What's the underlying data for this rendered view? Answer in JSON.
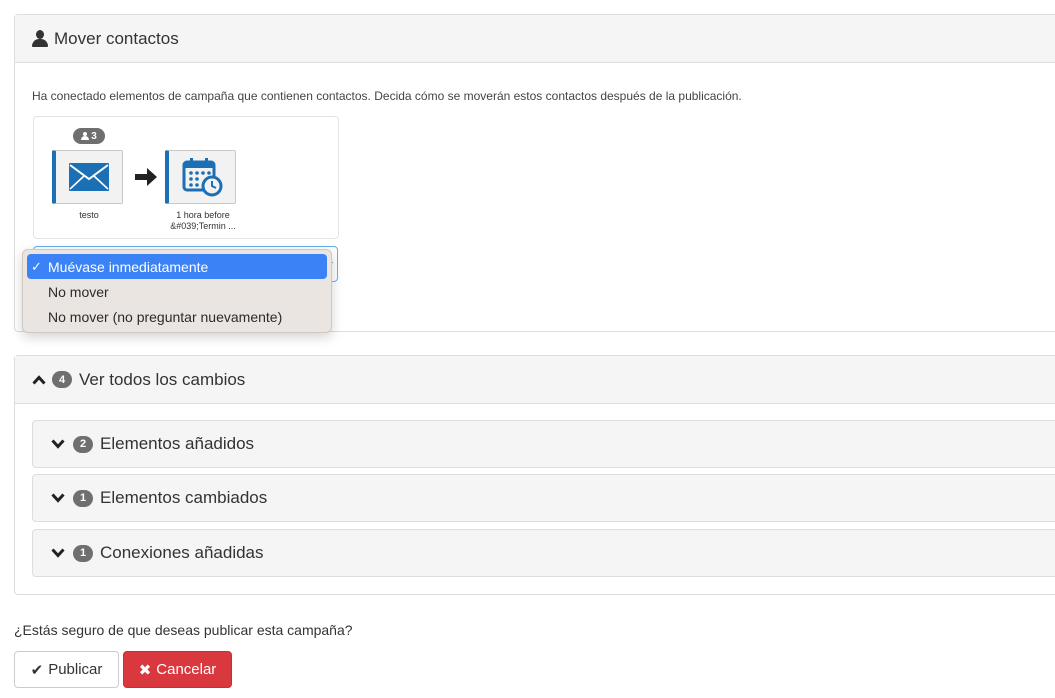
{
  "move_panel": {
    "title": "Mover contactos",
    "description": "Ha conectado elementos de campaña que contienen contactos. Decida cómo se moverán estos contactos después de la publicación.",
    "contact_count": "3",
    "nodes": [
      {
        "label": "testo",
        "icon": "envelope-icon"
      },
      {
        "label_line1": "1 hora before",
        "label_line2": "&#039;Termin ...",
        "icon": "calendar-clock-icon"
      }
    ],
    "select": {
      "selected_value": "Muévase inmediatamente",
      "options": [
        "Muévase inmediatamente",
        "No mover",
        "No mover (no preguntar nuevamente)"
      ]
    }
  },
  "changes_panel": {
    "title": "Ver todos los cambios",
    "count": "4",
    "sections": [
      {
        "count": "2",
        "title": "Elementos añadidos"
      },
      {
        "count": "1",
        "title": "Elementos cambiados"
      },
      {
        "count": "1",
        "title": "Conexiones añadidas"
      }
    ]
  },
  "footer": {
    "question": "¿Estás seguro de que deseas publicar esta campaña?",
    "publish_label": "Publicar",
    "cancel_label": "Cancelar"
  },
  "colors": {
    "accent_blue": "#1a6fb5",
    "selected_option": "#3b82f6",
    "cancel_red": "#d9383e",
    "badge_gray": "#6f6f6f"
  }
}
